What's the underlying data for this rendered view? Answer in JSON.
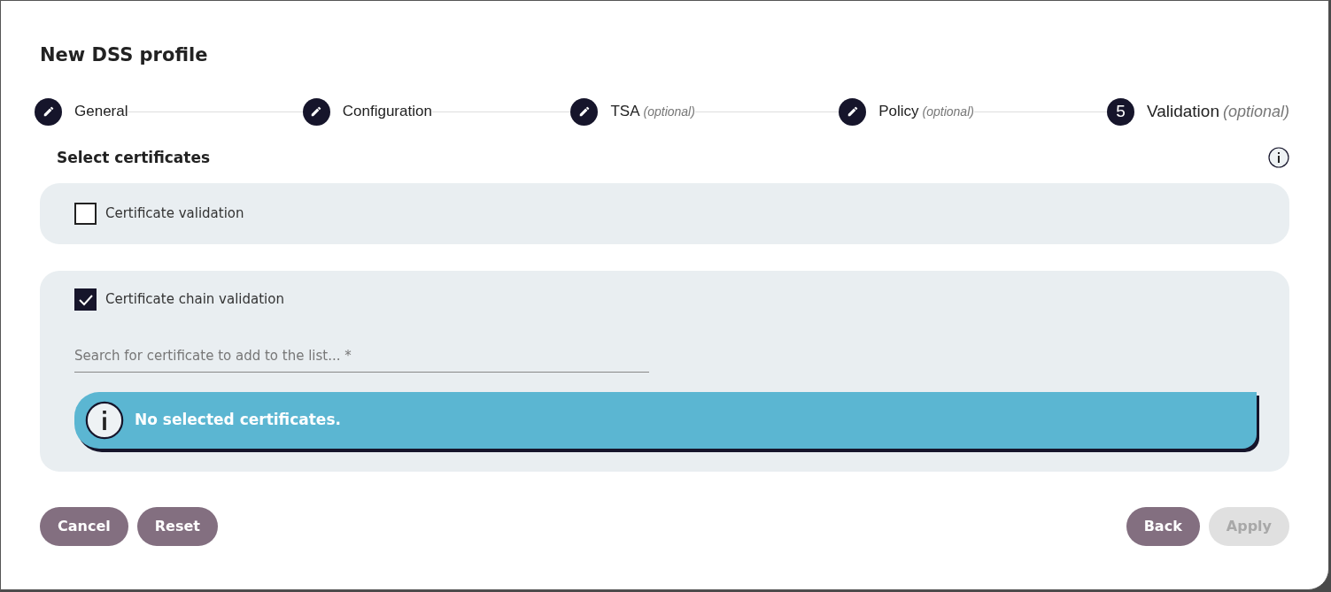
{
  "dialog": {
    "title": "New DSS profile"
  },
  "steps": [
    {
      "kind": "done",
      "label": "General",
      "selected": false
    },
    {
      "kind": "done",
      "label": "Configuration",
      "selected": false
    },
    {
      "kind": "done",
      "label": "TSA",
      "note": "(optional)",
      "selected": false
    },
    {
      "kind": "done",
      "label": "Policy",
      "note": "(optional)",
      "selected": false
    },
    {
      "kind": "current",
      "number": "5",
      "label": "Validation",
      "note": "(optional)",
      "selected": true
    }
  ],
  "section": {
    "title": "Select certificates"
  },
  "options": [
    {
      "label": "Certificate validation",
      "checked": false
    },
    {
      "label": "Certificate chain validation",
      "checked": true,
      "search": {
        "placeholder": "Search for certificate to add to the list... *"
      },
      "notice": "No selected certificates."
    }
  ],
  "buttons_left": [
    {
      "label": "Cancel",
      "disabled": false
    },
    {
      "label": "Reset",
      "disabled": false
    }
  ],
  "buttons_right": [
    {
      "label": "Back",
      "disabled": false
    },
    {
      "label": "Apply",
      "disabled": true
    }
  ]
}
